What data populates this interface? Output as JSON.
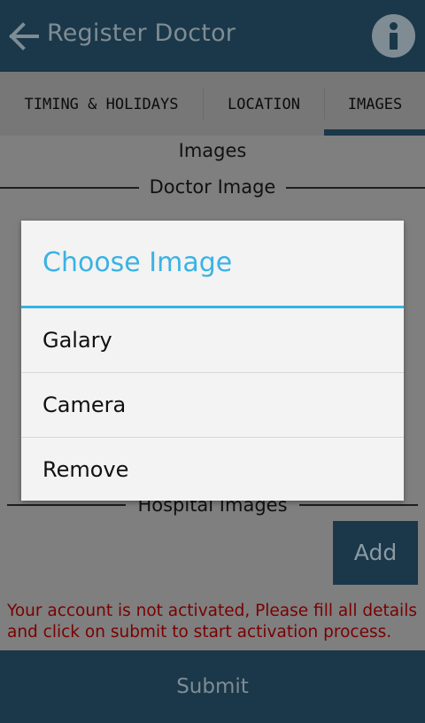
{
  "appbar": {
    "title": "Register Doctor"
  },
  "tabs": [
    {
      "label": "TIMING & HOLIDAYS"
    },
    {
      "label": "LOCATION"
    },
    {
      "label": "IMAGES"
    }
  ],
  "content": {
    "section_title": "Images",
    "doctor_image_label": "Doctor Image",
    "hospital_images_label": "Hospital Images",
    "add_label": "Add",
    "error_message": "Your account is not activated, Please fill all details and click on submit to start activation process.",
    "submit_label": "Submit"
  },
  "dialog": {
    "title": "Choose Image",
    "options": [
      {
        "label": "Galary"
      },
      {
        "label": "Camera"
      },
      {
        "label": "Remove"
      }
    ]
  },
  "colors": {
    "primary": "#1e4a63",
    "accent": "#3ab3e3",
    "error": "#c00000"
  }
}
